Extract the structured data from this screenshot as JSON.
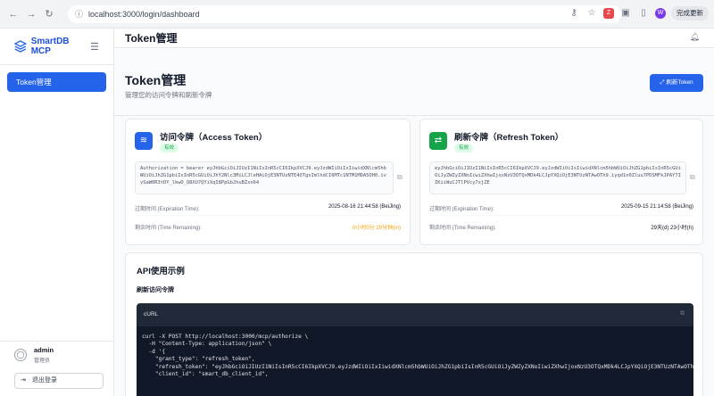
{
  "browser": {
    "url": "localhost:3000/login/dashboard",
    "update_label": "完成更新"
  },
  "sidebar": {
    "brand": "SmartDB MCP",
    "items": [
      {
        "label": "Token管理",
        "active": true
      }
    ],
    "user": {
      "name": "admin",
      "role": "管理员"
    },
    "logout_label": "退出登录"
  },
  "topbar": {
    "title": "Token管理"
  },
  "page": {
    "title": "Token管理",
    "subtitle": "管理您的访问令牌和刷新令牌",
    "refresh_button": "刷新Token"
  },
  "access_card": {
    "title": "访问令牌（Access Token）",
    "status": "有效",
    "token": "Authorization = bearer eyJhbGciOiJIUzI1NiIsInR5cCI6IkpXVCJ9.eyJzdWIiOiIxIiwidXNlcm5hbWUiOiJhZG1pbiIsInR5cGUiOiJhY2Nlc3MiLCJleHAiOjE3NTUzNTE4OTgsImlhdCI6MTc1NTM1MDA5OH0.ivvSaW0R3tDY_lkwO_Q8XU7QYiXqI8PpGb2huBZxn64",
    "expire_label": "过期时间 (Expiration Time):",
    "expire_value": "2025-08-16 21:44:58 (BeiJing)",
    "remain_label": "剩余时间 (Time Remaining):",
    "remain_value": "0小时0分 29分钟(m)",
    "remain_color": "#f59e0b",
    "icon_color": "#2563eb"
  },
  "refresh_card": {
    "title": "刷新令牌（Refresh Token）",
    "status": "有效",
    "token": "eyJhbGciOiJIUzI1NiIsInR5cCI6IkpXVCJ9.eyJzdWIiOiIxIiwidXNlcm5hbWUiOiJhZG1pbiIsInR5cGUiOiJyZWZyZXNoIiwiZXhwIjoxNzU3OTQxMDk4LCJpYXQiOjE3NTUzNTAwOTh9.iyqd1n0Zluu7PDSMFkJPAY7IIKiiWuCJTlPVcy7xjZE",
    "expire_label": "过期时间 (Expiration Time):",
    "expire_value": "2025-09-15 21:14:58 (BeiJing)",
    "remain_label": "剩余时间 (Time Remaining):",
    "remain_value": "29天(d) 23小时(h)",
    "icon_color": "#16a34a"
  },
  "api": {
    "title": "API使用示例",
    "subtitle": "刷新访问令牌",
    "lang": "cURL",
    "code": "curl -X POST http://localhost:3000/mcp/authorize \\\n  -H \"Content-Type: application/json\" \\\n  -d '{\n    \"grant_type\": \"refresh_token\",\n    \"refresh_token\": \"eyJhbGciOiJIUzI1NiIsInR5cCI6IkpXVCJ9.eyJzdWIiOiIxIiwidXNlcm5hbWUiOiJhZG1pbiIsInR5cGUiOiJyZWZyZXNoIiwiZXhwIjoxNzU3OTQxMDk4LCJpYXQiOjE3NTUzNTAwOTh9.iyqd1n0Zluu7PDSMFkJPAY7IIKiiWuCJTlPVcy7xjZE\",\n    \"client_id\": \"smart_db_client_id\","
  }
}
